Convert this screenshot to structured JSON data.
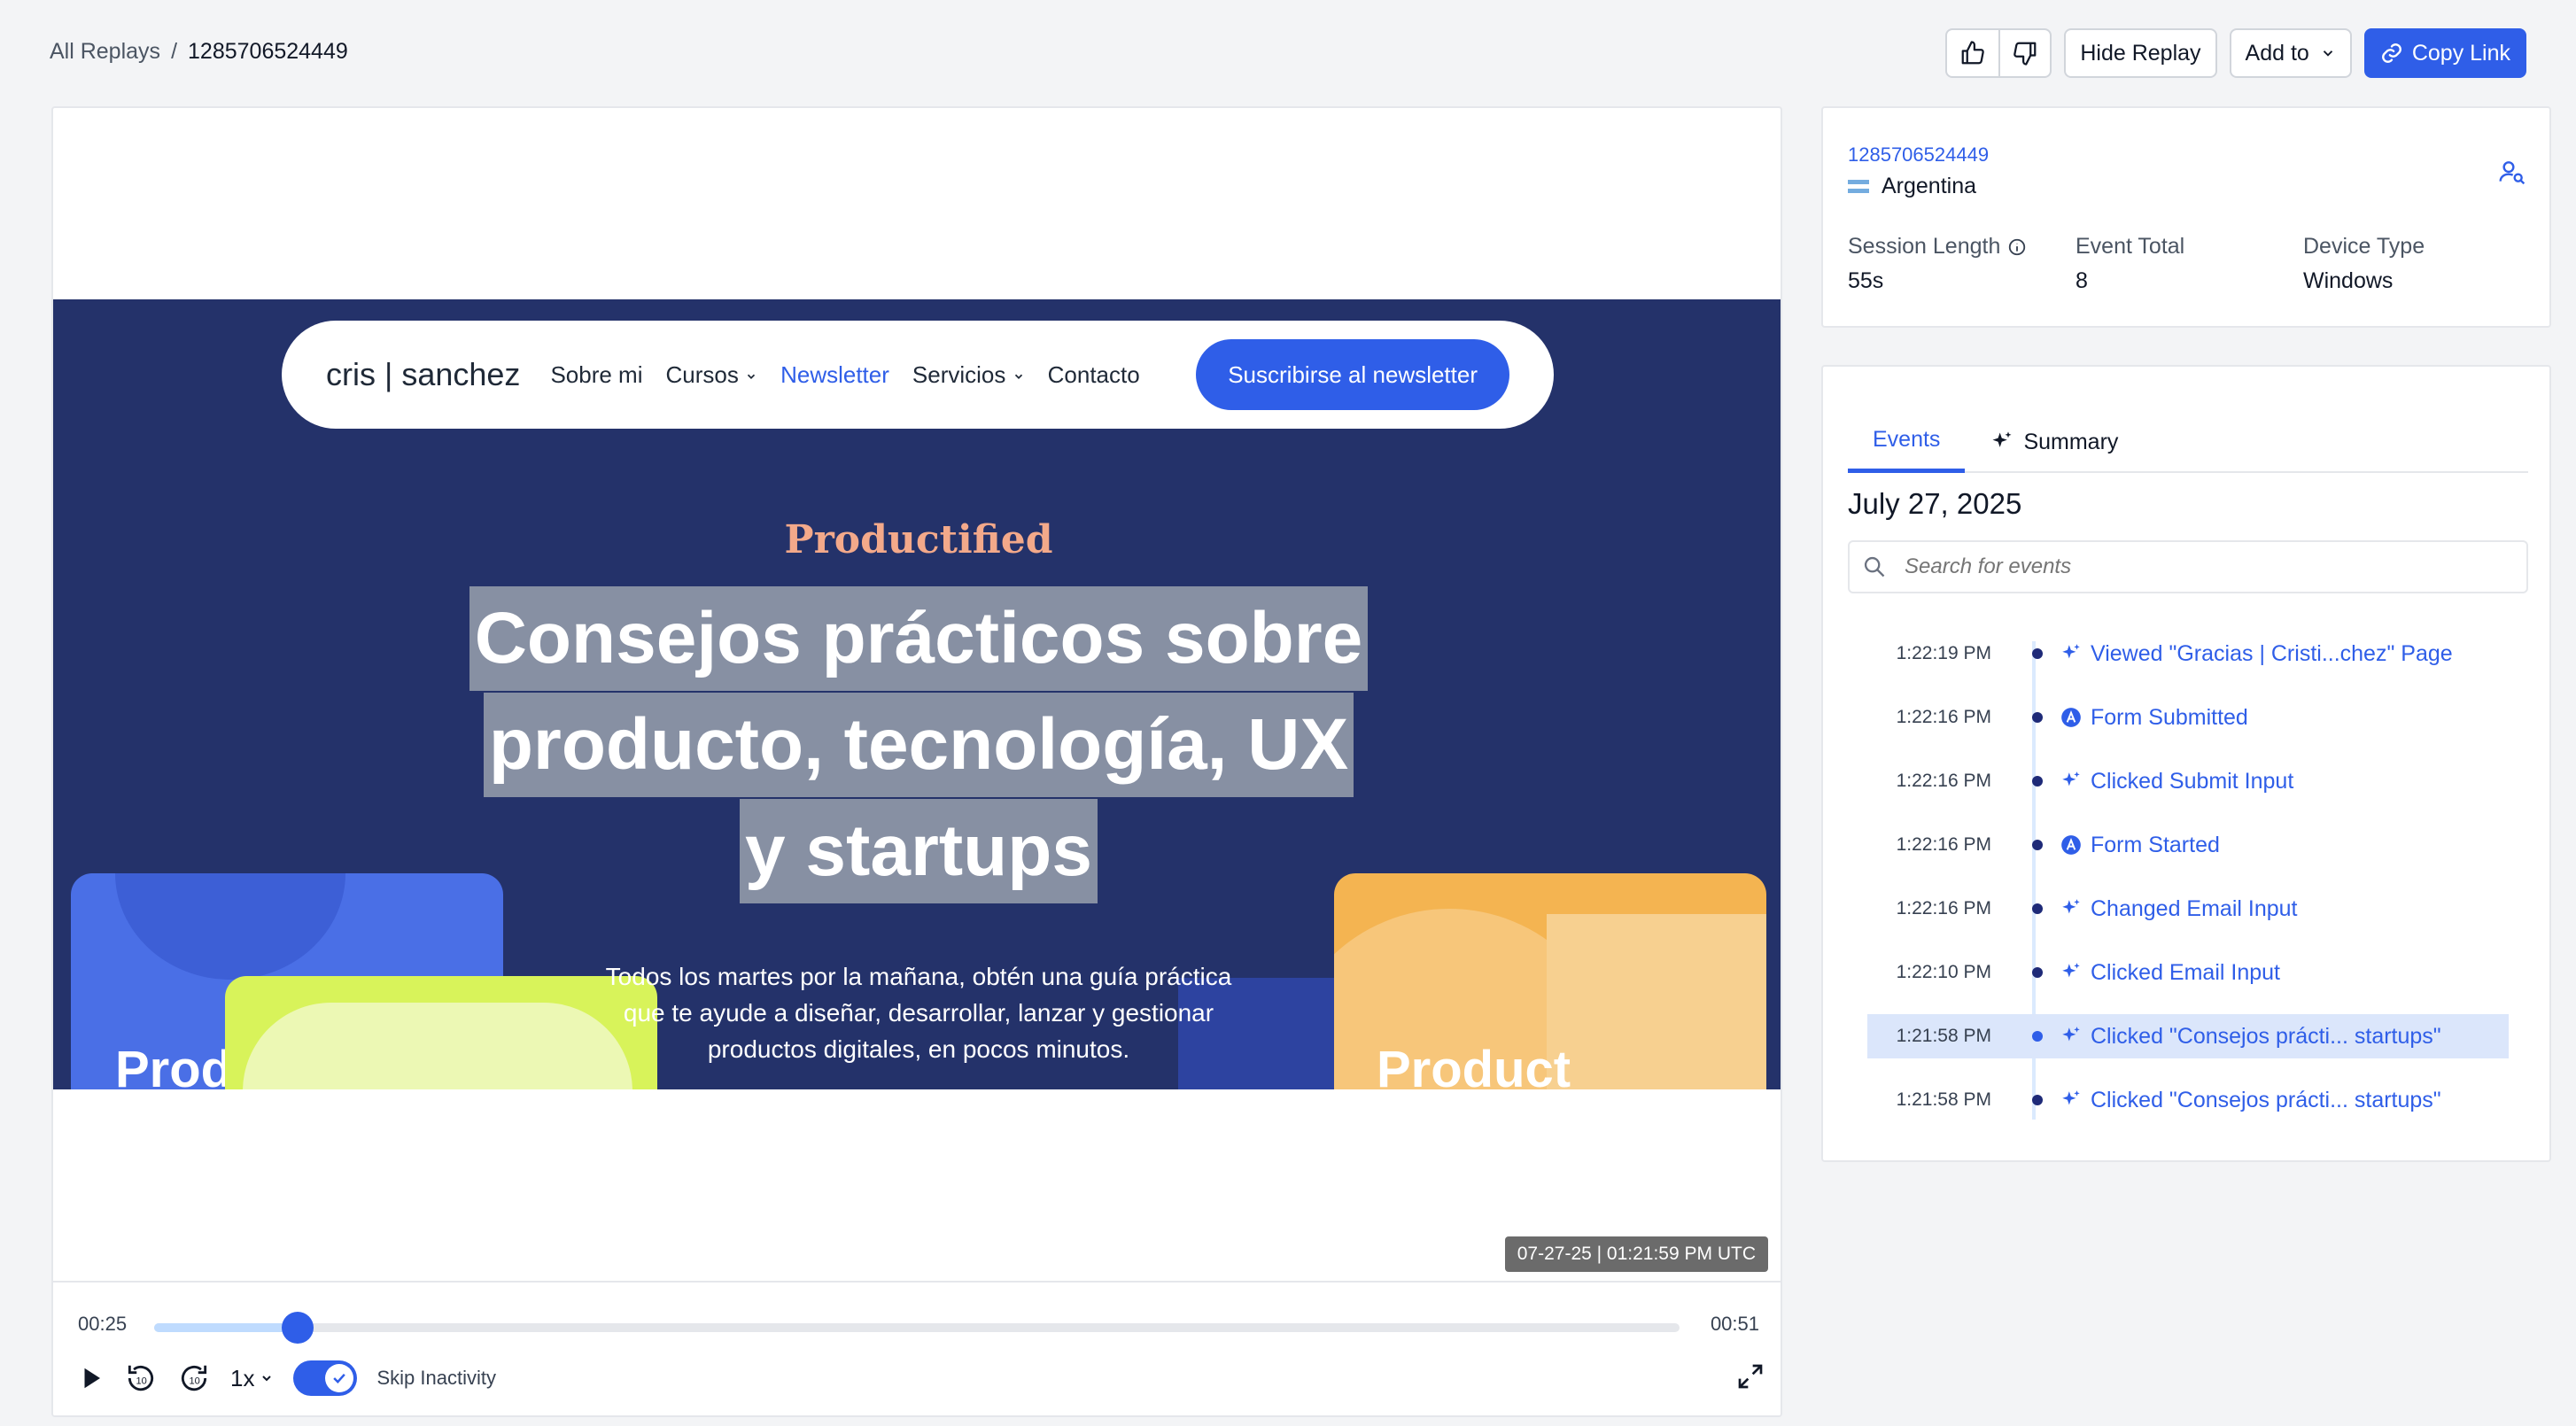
{
  "breadcrumb": {
    "root": "All Replays",
    "separator": "/",
    "current": "1285706524449"
  },
  "toolbar": {
    "hide_label": "Hide Replay",
    "add_label": "Add to",
    "copy_label": "Copy Link"
  },
  "replay": {
    "site": {
      "logo": "cris | sanchez",
      "nav": [
        "Sobre mi",
        "Cursos",
        "Newsletter",
        "Servicios",
        "Contacto"
      ],
      "cta": "Suscribirse al newsletter",
      "eyebrow": "Productified",
      "headline": [
        "Consejos prácticos sobre",
        "producto, tecnología, UX",
        "y startups"
      ],
      "sub": [
        "Todos los martes por la mañana, obtén una guía práctica",
        "que te ayude a diseñar, desarrollar, lanzar y gestionar",
        "productos digitales, en pocos minutos."
      ],
      "card_left": "Product",
      "card_right": "Product"
    },
    "timestamp": "07-27-25 | 01:21:59 PM UTC",
    "current_time": "00:25",
    "total_time": "00:51",
    "progress": 0.094,
    "speed": "1x",
    "skip_label": "Skip Inactivity",
    "skip_enabled": true
  },
  "session": {
    "id": "1285706524449",
    "country": "Argentina",
    "stats": [
      {
        "label": "Session Length",
        "value": "55s"
      },
      {
        "label": "Event Total",
        "value": "8"
      },
      {
        "label": "Device Type",
        "value": "Windows"
      }
    ]
  },
  "events_panel": {
    "tabs": [
      "Events",
      "Summary"
    ],
    "date": "July 27, 2025",
    "search_placeholder": "Search for events",
    "events": [
      {
        "time": "1:22:19 PM",
        "label": "Viewed \"Gracias | Cristi...chez\" Page",
        "icon": "sparkle-icon",
        "selected": false
      },
      {
        "time": "1:22:16 PM",
        "label": "Form Submitted",
        "icon": "form-icon",
        "selected": false
      },
      {
        "time": "1:22:16 PM",
        "label": "Clicked Submit Input",
        "icon": "sparkle-icon",
        "selected": false
      },
      {
        "time": "1:22:16 PM",
        "label": "Form Started",
        "icon": "form-icon",
        "selected": false
      },
      {
        "time": "1:22:16 PM",
        "label": "Changed Email Input",
        "icon": "sparkle-icon",
        "selected": false
      },
      {
        "time": "1:22:10 PM",
        "label": "Clicked Email Input",
        "icon": "sparkle-icon",
        "selected": false
      },
      {
        "time": "1:21:58 PM",
        "label": "Clicked \"Consejos prácti...  startups\"",
        "icon": "sparkle-icon",
        "selected": true
      },
      {
        "time": "1:21:58 PM",
        "label": "Clicked \"Consejos prácti...  startups\"",
        "icon": "sparkle-icon",
        "selected": false
      }
    ]
  },
  "colors": {
    "accent": "#2f5ee8",
    "stage_bg": "#24326a",
    "selected_row": "#dbe6fb"
  }
}
